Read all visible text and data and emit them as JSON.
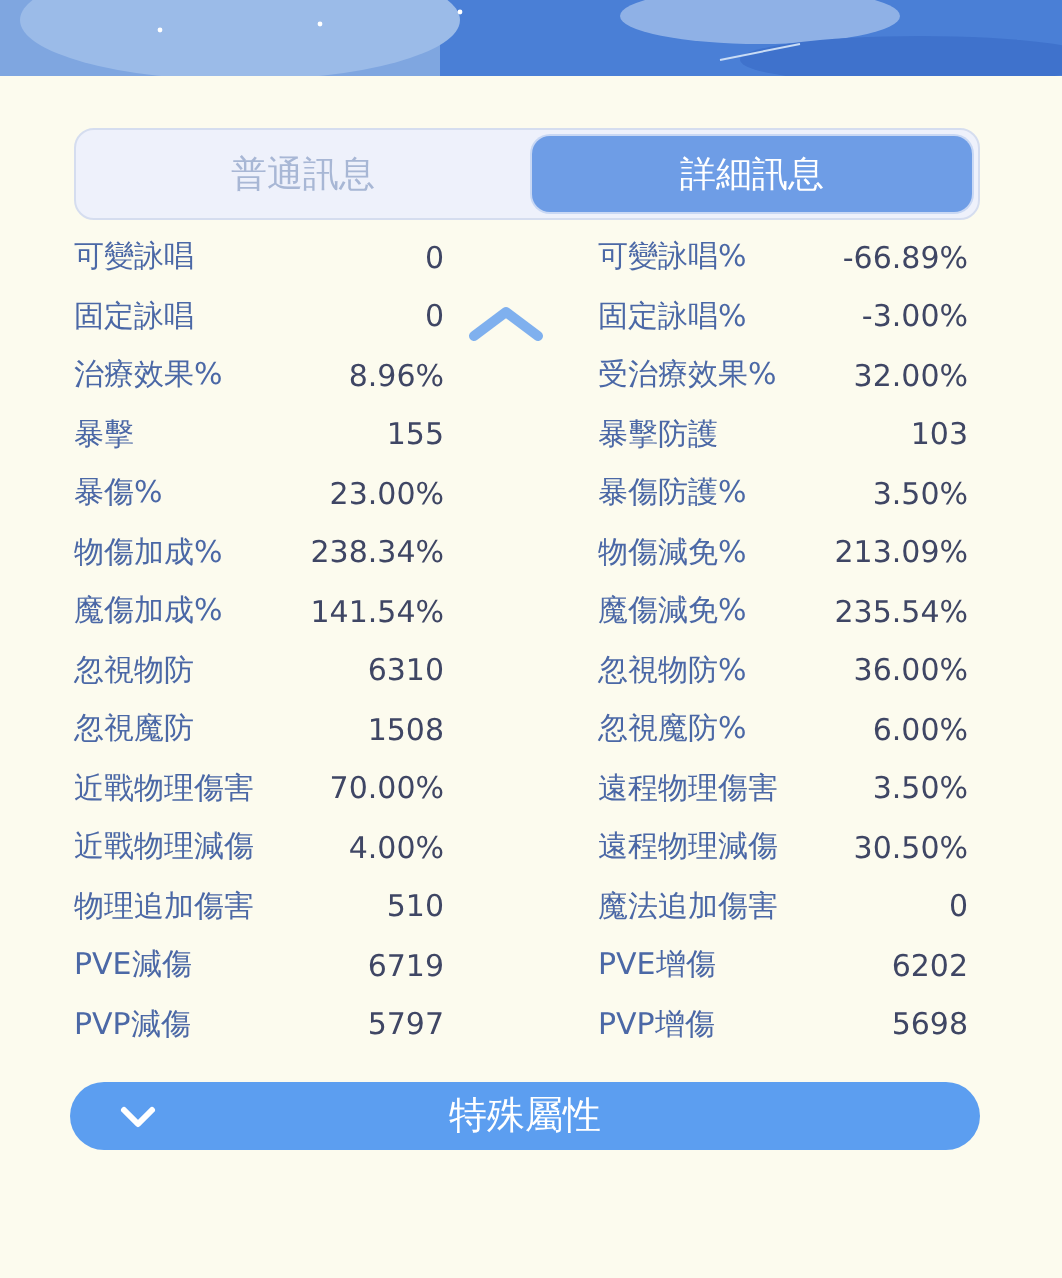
{
  "tabs": [
    {
      "label": "普通訊息",
      "selected": false
    },
    {
      "label": "詳細訊息",
      "selected": true
    }
  ],
  "stats": [
    {
      "left": {
        "label": "可變詠唱",
        "value": "0"
      },
      "right": {
        "label": "可變詠唱%",
        "value": "-66.89%"
      }
    },
    {
      "left": {
        "label": "固定詠唱",
        "value": "0"
      },
      "right": {
        "label": "固定詠唱%",
        "value": "-3.00%"
      }
    },
    {
      "left": {
        "label": "治療效果%",
        "value": "8.96%"
      },
      "right": {
        "label": "受治療效果%",
        "value": "32.00%"
      }
    },
    {
      "left": {
        "label": "暴擊",
        "value": "155"
      },
      "right": {
        "label": "暴擊防護",
        "value": "103"
      }
    },
    {
      "left": {
        "label": "暴傷%",
        "value": "23.00%"
      },
      "right": {
        "label": "暴傷防護%",
        "value": "3.50%"
      }
    },
    {
      "left": {
        "label": "物傷加成%",
        "value": "238.34%"
      },
      "right": {
        "label": "物傷減免%",
        "value": "213.09%"
      }
    },
    {
      "left": {
        "label": "魔傷加成%",
        "value": "141.54%"
      },
      "right": {
        "label": "魔傷減免%",
        "value": "235.54%"
      }
    },
    {
      "left": {
        "label": "忽視物防",
        "value": "6310"
      },
      "right": {
        "label": "忽視物防%",
        "value": "36.00%"
      }
    },
    {
      "left": {
        "label": "忽視魔防",
        "value": "1508"
      },
      "right": {
        "label": "忽視魔防%",
        "value": "6.00%"
      }
    },
    {
      "left": {
        "label": "近戰物理傷害",
        "value": "70.00%"
      },
      "right": {
        "label": "遠程物理傷害",
        "value": "3.50%"
      }
    },
    {
      "left": {
        "label": "近戰物理減傷",
        "value": "4.00%"
      },
      "right": {
        "label": "遠程物理減傷",
        "value": "30.50%"
      }
    },
    {
      "left": {
        "label": "物理追加傷害",
        "value": "510"
      },
      "right": {
        "label": "魔法追加傷害",
        "value": "0"
      }
    },
    {
      "left": {
        "label": "PVE減傷",
        "value": "6719"
      },
      "right": {
        "label": "PVE增傷",
        "value": "6202"
      }
    },
    {
      "left": {
        "label": "PVP減傷",
        "value": "5797"
      },
      "right": {
        "label": "PVP增傷",
        "value": "5698"
      }
    }
  ],
  "section": {
    "title": "特殊屬性",
    "expanded": false
  }
}
